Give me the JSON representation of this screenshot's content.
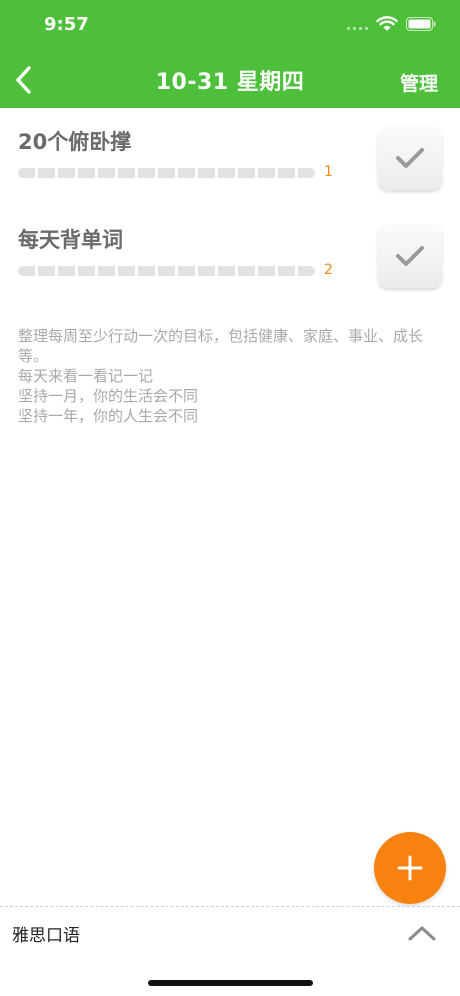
{
  "status_bar": {
    "time": "9:57"
  },
  "nav": {
    "title": "10-31 星期四",
    "manage_label": "管理"
  },
  "tasks": [
    {
      "title": "20个俯卧撑",
      "count": "1"
    },
    {
      "title": "每天背单词",
      "count": "2"
    }
  ],
  "hint_lines": [
    "整理每周至少行动一次的目标，包括健康、家庭、事业、成长等。",
    "每天来看一看记一记",
    "坚持一月，你的生活会不同",
    "坚持一年，你的人生会不同"
  ],
  "bottom_bar": {
    "label": "雅思口语"
  },
  "colors": {
    "header": "#4dbf3a",
    "accent": "#f7820f",
    "count": "#f08a1a",
    "hint": "#a9a9a9"
  },
  "icons": {
    "back": "chevron-left-icon",
    "check": "checkmark-icon",
    "add": "plus-icon",
    "expand": "chevron-up-icon"
  }
}
